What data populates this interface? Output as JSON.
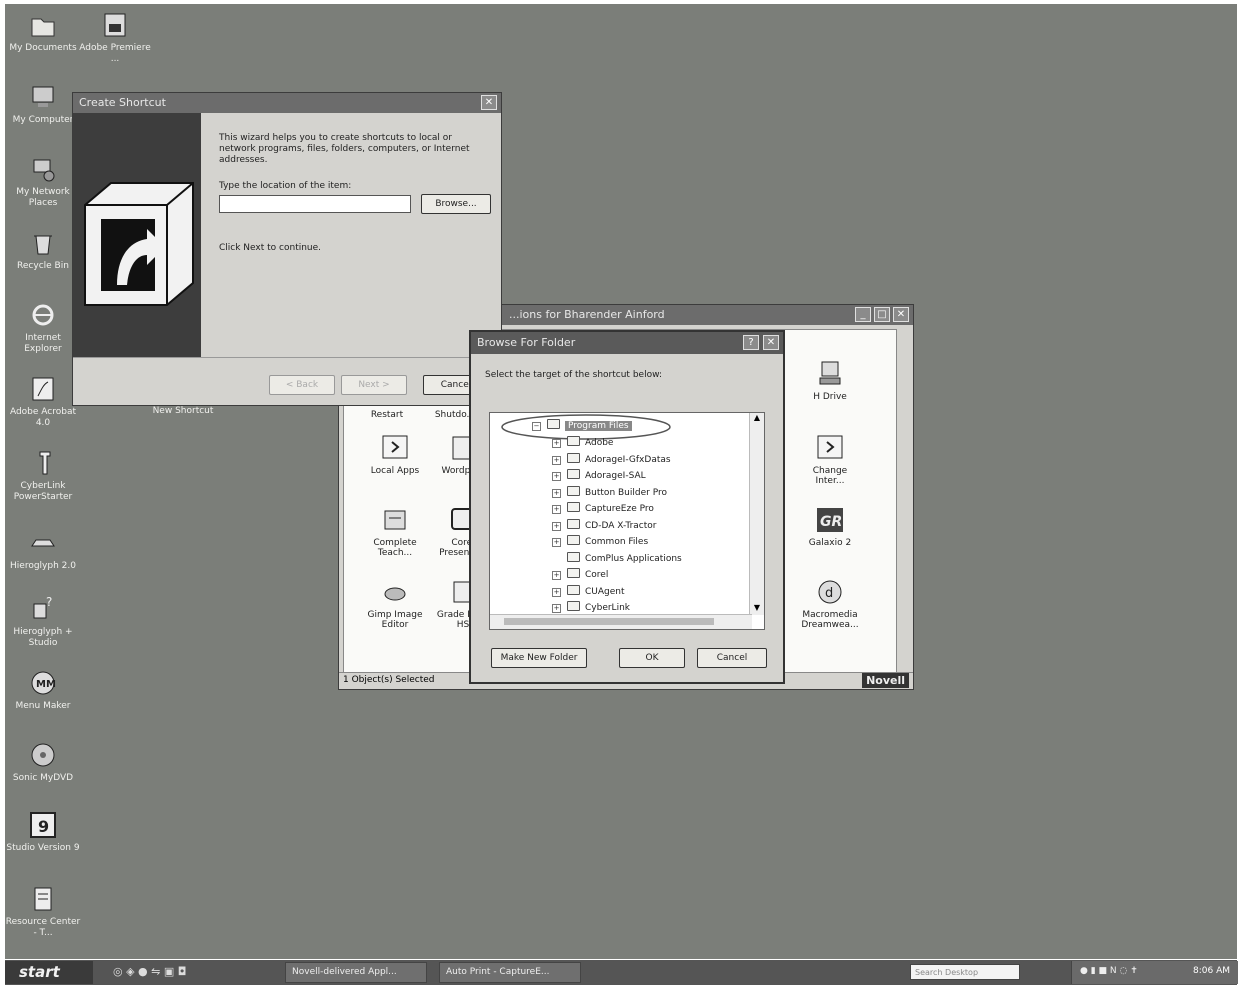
{
  "desktop_icons": [
    {
      "label": "My Documents",
      "icon": "folder-icon"
    },
    {
      "label": "Adobe Premiere ...",
      "icon": "premiere-icon"
    },
    {
      "label": "My Computer",
      "icon": "computer-icon"
    },
    {
      "label": "My Network Places",
      "icon": "network-icon"
    },
    {
      "label": "Recycle Bin",
      "icon": "recycle-bin-icon"
    },
    {
      "label": "Internet Explorer",
      "icon": "ie-icon"
    },
    {
      "label": "Adobe Acrobat 4.0",
      "icon": "acrobat-icon"
    },
    {
      "label": "CyberLink PowerStarter",
      "icon": "cyberlink-icon"
    },
    {
      "label": "Hieroglyph 2.0",
      "icon": "hieroglyph-icon"
    },
    {
      "label": "Hieroglyph + Studio",
      "icon": "hieroglyph-studio-icon"
    },
    {
      "label": "Menu Maker",
      "icon": "menu-maker-icon"
    },
    {
      "label": "Sonic MyDVD",
      "icon": "mydvd-icon"
    },
    {
      "label": "Studio Version 9",
      "icon": "studio-icon"
    },
    {
      "label": "Resource Center - T...",
      "icon": "resource-center-icon"
    },
    {
      "label": "New Shortcut",
      "icon": "shortcut-icon"
    }
  ],
  "create_shortcut": {
    "title": "Create Shortcut",
    "intro": "This wizard helps you to create shortcuts to local or network programs, files, folders, computers, or Internet addresses.",
    "location_label": "Type the location of the item:",
    "location_value": "",
    "browse": "Browse...",
    "continue_text": "Click Next to continue.",
    "back": "< Back",
    "next": "Next >",
    "cancel": "Cancel"
  },
  "explorer": {
    "title": "...ions for Bharender Ainford",
    "status": "1 Object(s) Selected",
    "brand": "Novell",
    "items": [
      "Restart",
      "Shutdo...",
      "Local Apps",
      "Wordpa...",
      "Complete Teach...",
      "Corel Presenta...",
      "Gimp Image Editor",
      "Grade Ma... HS"
    ],
    "right_items": [
      "H Drive",
      "Change Inter...",
      "Galaxio 2",
      "Macromedia Dreamwea..."
    ]
  },
  "browse_folder": {
    "title": "Browse For Folder",
    "help": "?",
    "close": "✕",
    "prompt": "Select the target of the shortcut below:",
    "selected": "Program Files",
    "tree": [
      "Adobe",
      "AdorageI-GfxDatas",
      "AdorageI-SAL",
      "Button Builder Pro",
      "CaptureEze Pro",
      "CD-DA X-Tractor",
      "Common Files",
      "ComPlus Applications",
      "Corel",
      "CUAgent",
      "CyberLink"
    ],
    "make_new_folder": "Make New Folder",
    "ok": "OK",
    "cancel": "Cancel"
  },
  "taskbar": {
    "start": "start",
    "tasks": [
      "Novell-delivered Appl...",
      "Auto Print - CaptureE..."
    ],
    "search_placeholder": "Search Desktop",
    "clock": "8:06 AM"
  }
}
